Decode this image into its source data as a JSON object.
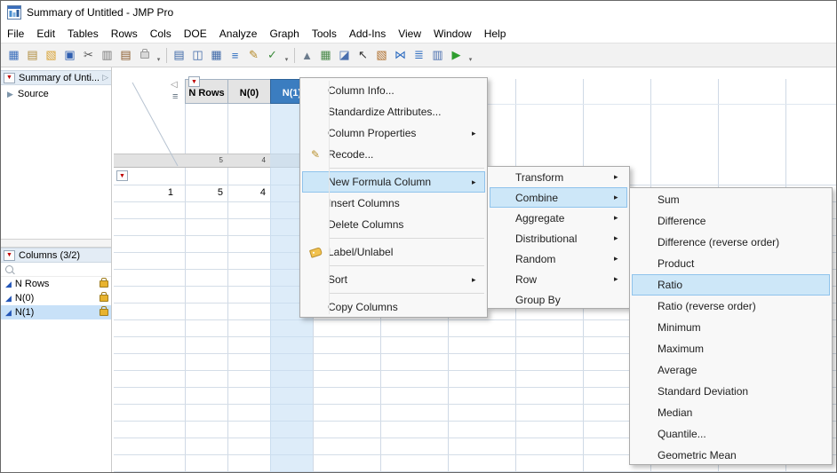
{
  "window": {
    "title": "Summary of Untitled - JMP Pro"
  },
  "menu_bar": {
    "items": [
      "File",
      "Edit",
      "Tables",
      "Rows",
      "Cols",
      "DOE",
      "Analyze",
      "Graph",
      "Tools",
      "Add-Ins",
      "View",
      "Window",
      "Help"
    ]
  },
  "toolbar": {
    "items": [
      {
        "type": "icon",
        "name": "new-data-table-icon",
        "glyph": "▦",
        "color": "#3a6ebc"
      },
      {
        "type": "icon",
        "name": "new-journal-icon",
        "glyph": "▤",
        "color": "#b08c3e"
      },
      {
        "type": "icon",
        "name": "open-icon",
        "glyph": "▧",
        "color": "#d9a335"
      },
      {
        "type": "icon",
        "name": "save-icon",
        "glyph": "▣",
        "color": "#2f5fb0"
      },
      {
        "type": "icon",
        "name": "cut-icon",
        "glyph": "✂",
        "color": "#555555"
      },
      {
        "type": "icon",
        "name": "copy-icon",
        "glyph": "▥",
        "color": "#777777"
      },
      {
        "type": "icon",
        "name": "paste-icon",
        "glyph": "▤",
        "color": "#8a5a2b"
      },
      {
        "type": "lock",
        "name": "data-lock-icon"
      },
      {
        "type": "overflow"
      },
      {
        "type": "separator"
      },
      {
        "type": "icon",
        "name": "journal-icon",
        "glyph": "▤",
        "color": "#3f69a8"
      },
      {
        "type": "icon",
        "name": "layout-window-icon",
        "glyph": "◫",
        "color": "#3f69a8"
      },
      {
        "type": "icon",
        "name": "split-window-icon",
        "glyph": "▦",
        "color": "#3f69a8"
      },
      {
        "type": "icon",
        "name": "tabulate-icon",
        "glyph": "≡",
        "color": "#2d6cc0"
      },
      {
        "type": "icon",
        "name": "annotate-icon",
        "glyph": "✎",
        "color": "#b58a2a"
      },
      {
        "type": "icon",
        "name": "formula-check-icon",
        "glyph": "✓",
        "color": "#3a8a3a"
      },
      {
        "type": "overflow"
      },
      {
        "type": "separator"
      },
      {
        "type": "icon",
        "name": "sort-icon",
        "glyph": "▲",
        "color": "#6b7b8c"
      },
      {
        "type": "icon",
        "name": "new-column-icon",
        "glyph": "▦",
        "color": "#4a8a4a"
      },
      {
        "type": "icon",
        "name": "graph-window-icon",
        "glyph": "◪",
        "color": "#4a6fae"
      },
      {
        "type": "icon",
        "name": "selection-arrow-icon",
        "glyph": "↖",
        "color": "#333333"
      },
      {
        "type": "icon",
        "name": "table-edit-icon",
        "glyph": "▧",
        "color": "#b0702f"
      },
      {
        "type": "icon",
        "name": "join-tables-icon",
        "glyph": "⋈",
        "color": "#2d6cc0"
      },
      {
        "type": "icon",
        "name": "stack-columns-icon",
        "glyph": "≣",
        "color": "#2d6cc0"
      },
      {
        "type": "icon",
        "name": "data-table-icon",
        "glyph": "▥",
        "color": "#4a6fae"
      },
      {
        "type": "icon",
        "name": "run-script-icon",
        "glyph": "▶",
        "color": "#2f9e2f"
      },
      {
        "type": "overflow"
      }
    ]
  },
  "sidebar": {
    "table_panel": {
      "title": "Summary of Unti...",
      "source_label": "Source"
    },
    "columns_panel": {
      "title": "Columns (3/2)",
      "items": [
        {
          "label": "N Rows",
          "locked": true,
          "selected": false
        },
        {
          "label": "N(0)",
          "locked": true,
          "selected": false
        },
        {
          "label": "N(1)",
          "locked": true,
          "selected": true
        }
      ]
    }
  },
  "grid": {
    "columns": [
      {
        "label": "N Rows",
        "selected": false
      },
      {
        "label": "N(0)",
        "selected": false
      },
      {
        "label": "N(1)",
        "selected": true
      }
    ],
    "summary_values": [
      "5",
      "4",
      ""
    ],
    "rows": [
      {
        "number": "1",
        "values": [
          "5",
          "4",
          ""
        ]
      }
    ]
  },
  "context_menu": {
    "items": [
      {
        "label": "Column Info...",
        "type": "item"
      },
      {
        "label": "Standardize Attributes...",
        "type": "item"
      },
      {
        "label": "Column Properties",
        "type": "submenu"
      },
      {
        "label": "Recode...",
        "type": "item",
        "icon": "recode-icon"
      },
      {
        "type": "separator"
      },
      {
        "label": "New Formula Column",
        "type": "submenu",
        "highlighted": true
      },
      {
        "label": "Insert Columns",
        "type": "item"
      },
      {
        "label": "Delete Columns",
        "type": "item"
      },
      {
        "type": "separator"
      },
      {
        "label": "Label/Unlabel",
        "type": "item",
        "icon": "label-icon"
      },
      {
        "type": "separator"
      },
      {
        "label": "Sort",
        "type": "submenu"
      },
      {
        "type": "separator"
      },
      {
        "label": "Copy Columns",
        "type": "item"
      }
    ]
  },
  "formula_submenu": {
    "items": [
      {
        "label": "Transform",
        "type": "submenu"
      },
      {
        "label": "Combine",
        "type": "submenu",
        "highlighted": true
      },
      {
        "label": "Aggregate",
        "type": "submenu"
      },
      {
        "label": "Distributional",
        "type": "submenu"
      },
      {
        "label": "Random",
        "type": "submenu"
      },
      {
        "label": "Row",
        "type": "submenu"
      },
      {
        "label": "Group By",
        "type": "item"
      }
    ]
  },
  "combine_submenu": {
    "items": [
      {
        "label": "Sum",
        "type": "item"
      },
      {
        "label": "Difference",
        "type": "item"
      },
      {
        "label": "Difference (reverse order)",
        "type": "item"
      },
      {
        "label": "Product",
        "type": "item"
      },
      {
        "label": "Ratio",
        "type": "item",
        "highlighted": true
      },
      {
        "label": "Ratio (reverse order)",
        "type": "item"
      },
      {
        "label": "Minimum",
        "type": "item"
      },
      {
        "label": "Maximum",
        "type": "item"
      },
      {
        "label": "Average",
        "type": "item"
      },
      {
        "label": "Standard Deviation",
        "type": "item"
      },
      {
        "label": "Median",
        "type": "item"
      },
      {
        "label": "Quantile...",
        "type": "item"
      },
      {
        "label": "Geometric Mean",
        "type": "item"
      }
    ]
  },
  "colors": {
    "selected_header": "#3b7dc0",
    "menu_highlight": "#cde7f8",
    "red_triangle": "#bf0000"
  }
}
